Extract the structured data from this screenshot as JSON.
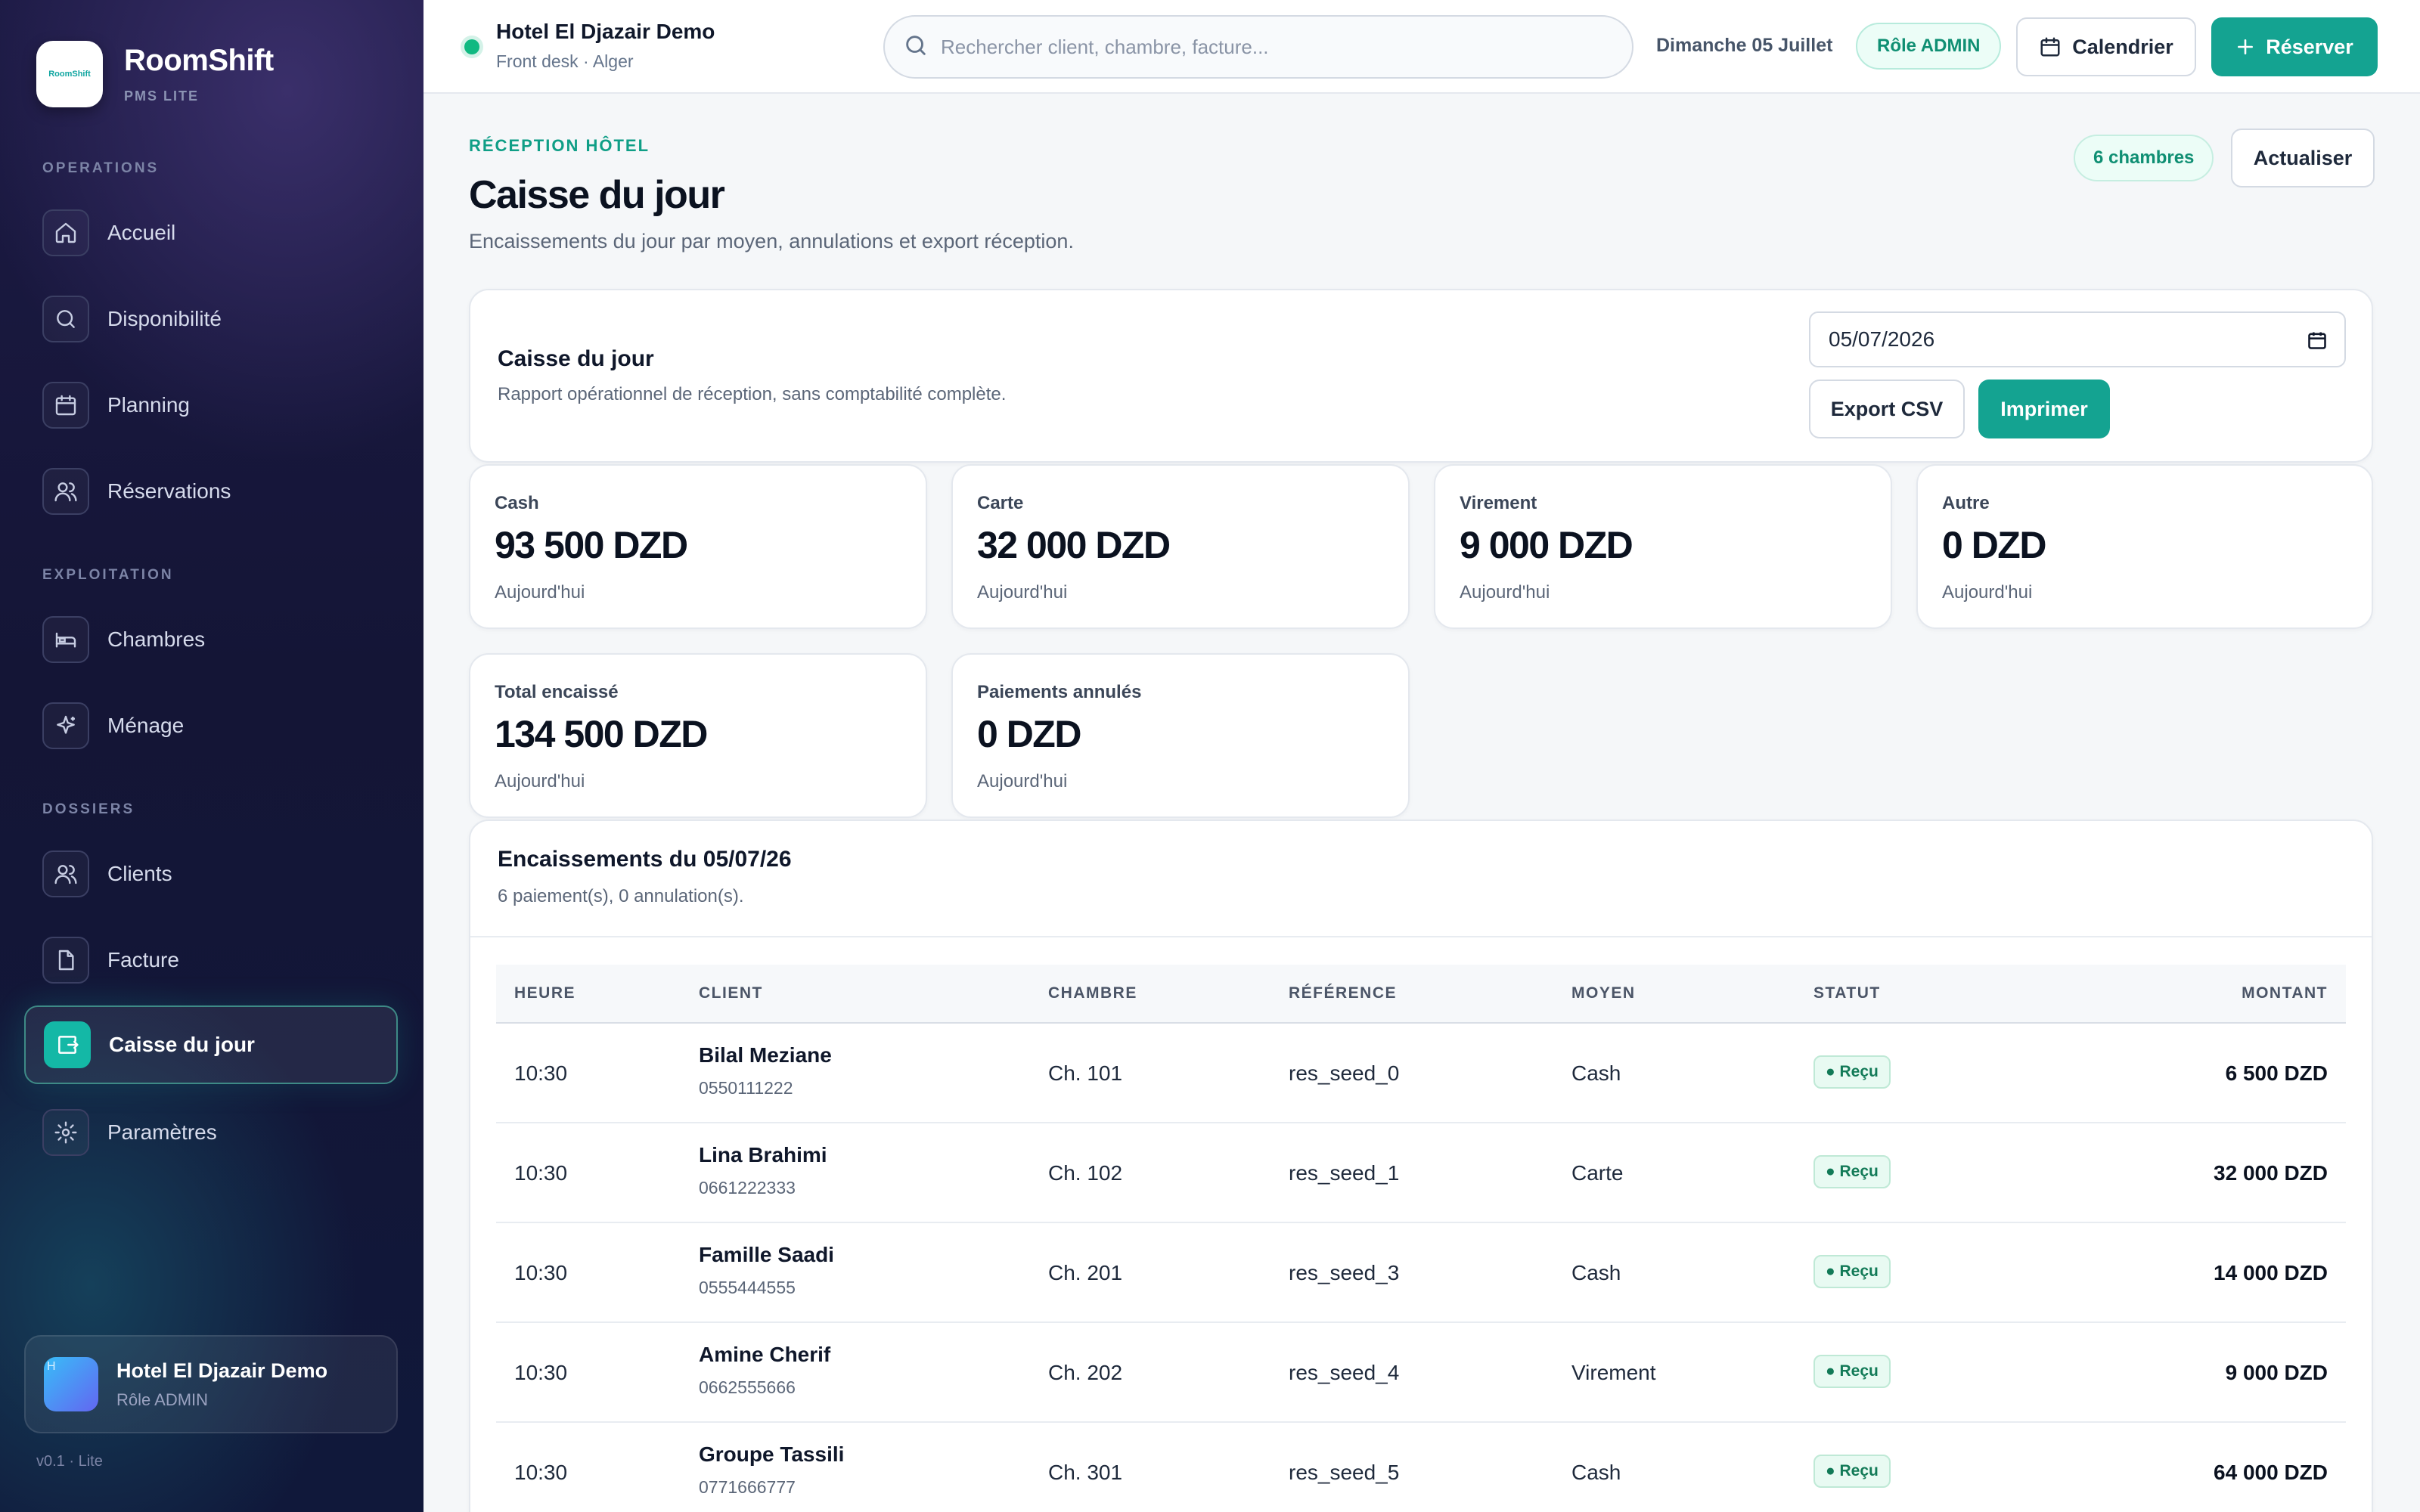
{
  "sidebar": {
    "brand": {
      "name": "RoomShift",
      "subtitle": "PMS LITE",
      "logo_text": "RoomShift"
    },
    "sections": {
      "operations": "OPERATIONS",
      "exploitation": "EXPLOITATION",
      "dossiers": "DOSSIERS"
    },
    "items": {
      "accueil": {
        "label": "Accueil",
        "icon": "home-icon"
      },
      "disponibilite": {
        "label": "Disponibilité",
        "icon": "search-icon"
      },
      "planning": {
        "label": "Planning",
        "icon": "calendar-icon"
      },
      "reservations": {
        "label": "Réservations",
        "icon": "users-icon"
      },
      "chambres": {
        "label": "Chambres",
        "icon": "bed-icon"
      },
      "menage": {
        "label": "Ménage",
        "icon": "sparkle-icon"
      },
      "clients": {
        "label": "Clients",
        "icon": "users-icon"
      },
      "facture": {
        "label": "Facture",
        "icon": "document-icon"
      },
      "caisse": {
        "label": "Caisse du jour",
        "icon": "cash-register-icon",
        "active": true
      },
      "parametres": {
        "label": "Paramètres",
        "icon": "gear-icon"
      }
    },
    "user": {
      "name": "Hotel El Djazair Demo",
      "role": "Rôle ADMIN",
      "avatar_letter": "H"
    },
    "version": "v0.1 · Lite"
  },
  "topbar": {
    "hotel_name": "Hotel El Djazair Demo",
    "hotel_sub": "Front desk · Alger",
    "search_placeholder": "Rechercher client, chambre, facture...",
    "date": "Dimanche 05 Juillet",
    "role_badge": "Rôle ADMIN",
    "calendar_button": "Calendrier",
    "reserve_button": "Réserver"
  },
  "header": {
    "eyebrow": "RÉCEPTION HÔTEL",
    "title": "Caisse du jour",
    "description": "Encaissements du jour par moyen, annulations et export réception.",
    "rooms_badge": "6 chambres",
    "refresh_button": "Actualiser"
  },
  "report": {
    "title": "Caisse du jour",
    "subtitle": "Rapport opérationnel de réception, sans comptabilité complète.",
    "date_value": "05/07/2026",
    "export_button": "Export CSV",
    "print_button": "Imprimer"
  },
  "stats": {
    "cash": {
      "label": "Cash",
      "value": "93 500 DZD",
      "sub": "Aujourd'hui"
    },
    "carte": {
      "label": "Carte",
      "value": "32 000 DZD",
      "sub": "Aujourd'hui"
    },
    "virement": {
      "label": "Virement",
      "value": "9 000 DZD",
      "sub": "Aujourd'hui"
    },
    "autre": {
      "label": "Autre",
      "value": "0 DZD",
      "sub": "Aujourd'hui"
    },
    "total": {
      "label": "Total encaissé",
      "value": "134 500 DZD",
      "sub": "Aujourd'hui"
    },
    "annules": {
      "label": "Paiements annulés",
      "value": "0 DZD",
      "sub": "Aujourd'hui"
    }
  },
  "payments": {
    "title": "Encaissements du 05/07/26",
    "subtitle": "6 paiement(s), 0 annulation(s).",
    "columns": {
      "heure": "HEURE",
      "client": "CLIENT",
      "chambre": "CHAMBRE",
      "reference": "RÉFÉRENCE",
      "moyen": "MOYEN",
      "statut": "STATUT",
      "montant": "MONTANT"
    },
    "rows": [
      {
        "heure": "10:30",
        "client": "Bilal Meziane",
        "phone": "0550111222",
        "chambre": "Ch. 101",
        "reference": "res_seed_0",
        "moyen": "Cash",
        "statut": "● Reçu",
        "montant": "6 500 DZD"
      },
      {
        "heure": "10:30",
        "client": "Lina Brahimi",
        "phone": "0661222333",
        "chambre": "Ch. 102",
        "reference": "res_seed_1",
        "moyen": "Carte",
        "statut": "● Reçu",
        "montant": "32 000 DZD"
      },
      {
        "heure": "10:30",
        "client": "Famille Saadi",
        "phone": "0555444555",
        "chambre": "Ch. 201",
        "reference": "res_seed_3",
        "moyen": "Cash",
        "statut": "● Reçu",
        "montant": "14 000 DZD"
      },
      {
        "heure": "10:30",
        "client": "Amine Cherif",
        "phone": "0662555666",
        "chambre": "Ch. 202",
        "reference": "res_seed_4",
        "moyen": "Virement",
        "statut": "● Reçu",
        "montant": "9 000 DZD"
      },
      {
        "heure": "10:30",
        "client": "Groupe Tassili",
        "phone": "0771666777",
        "chambre": "Ch. 301",
        "reference": "res_seed_5",
        "moyen": "Cash",
        "statut": "● Reçu",
        "montant": "64 000 DZD"
      }
    ]
  },
  "colors": {
    "accent": "#14a391",
    "sidebar_bg": "#16173a",
    "success": "#10b981"
  }
}
